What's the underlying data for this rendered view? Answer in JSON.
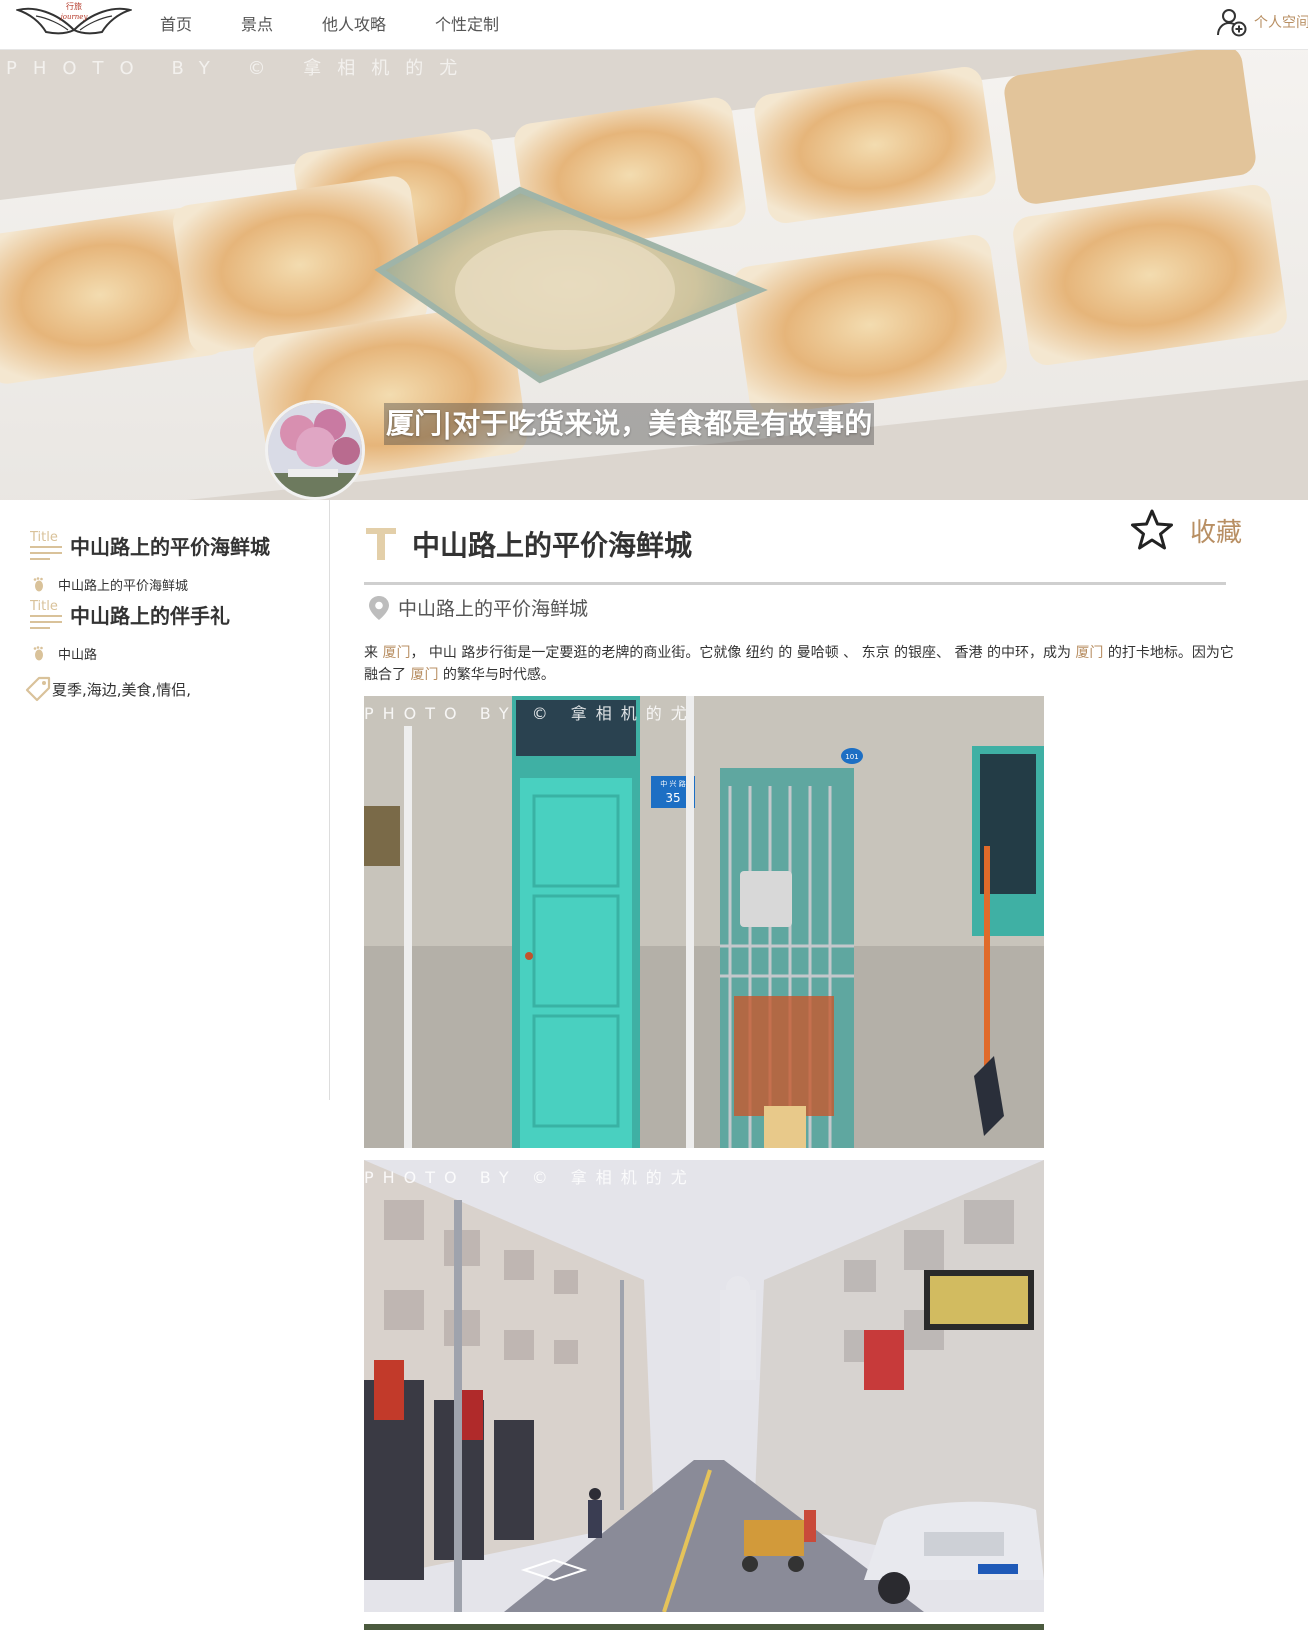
{
  "brand": {
    "logo_cn": "行旅",
    "logo_en": "journey"
  },
  "nav": {
    "items": [
      {
        "label": "首页"
      },
      {
        "label": "景点"
      },
      {
        "label": "他人攻略"
      },
      {
        "label": "个性定制"
      }
    ],
    "user_label": "个人空间"
  },
  "hero": {
    "watermark": "PHOTO BY © 拿相机的尤",
    "title": "厦门|对于吃货来说，美食都是有故事的"
  },
  "sidebar": {
    "sections": [
      {
        "icon_text": "Title",
        "title": "中山路上的平价海鲜城",
        "sub": "中山路上的平价海鲜城"
      },
      {
        "icon_text": "Title",
        "title": "中山路上的伴手礼",
        "sub": "中山路"
      }
    ],
    "tags": "夏季,海边,美食,情侣,"
  },
  "article": {
    "title": "中山路上的平价海鲜城",
    "fav_label": "收藏",
    "location": "中山路上的平价海鲜城",
    "paragraph": {
      "p1": "来 ",
      "h1": "厦门",
      "p2": "， 中山 路步行街是一定要逛的老牌的商业街。它就像 纽约 的 曼哈顿 、 东京 的银座、 香港 的中环，成为 ",
      "h2": "厦门",
      "p3": " 的打卡地标。因为它融合了 ",
      "h3": "厦门",
      "p4": " 的繁华与时代感。"
    },
    "photo1_watermark": "PHOTO BY © 拿相机的尤",
    "photo2_watermark": "PHOTO BY © 拿相机的尤",
    "door_sign": {
      "street": "中 兴 路",
      "number": "35",
      "plate": "101"
    }
  },
  "colors": {
    "accent": "#b88f63",
    "door_teal": "#49d0c0",
    "rule": "#cfcfcf"
  }
}
